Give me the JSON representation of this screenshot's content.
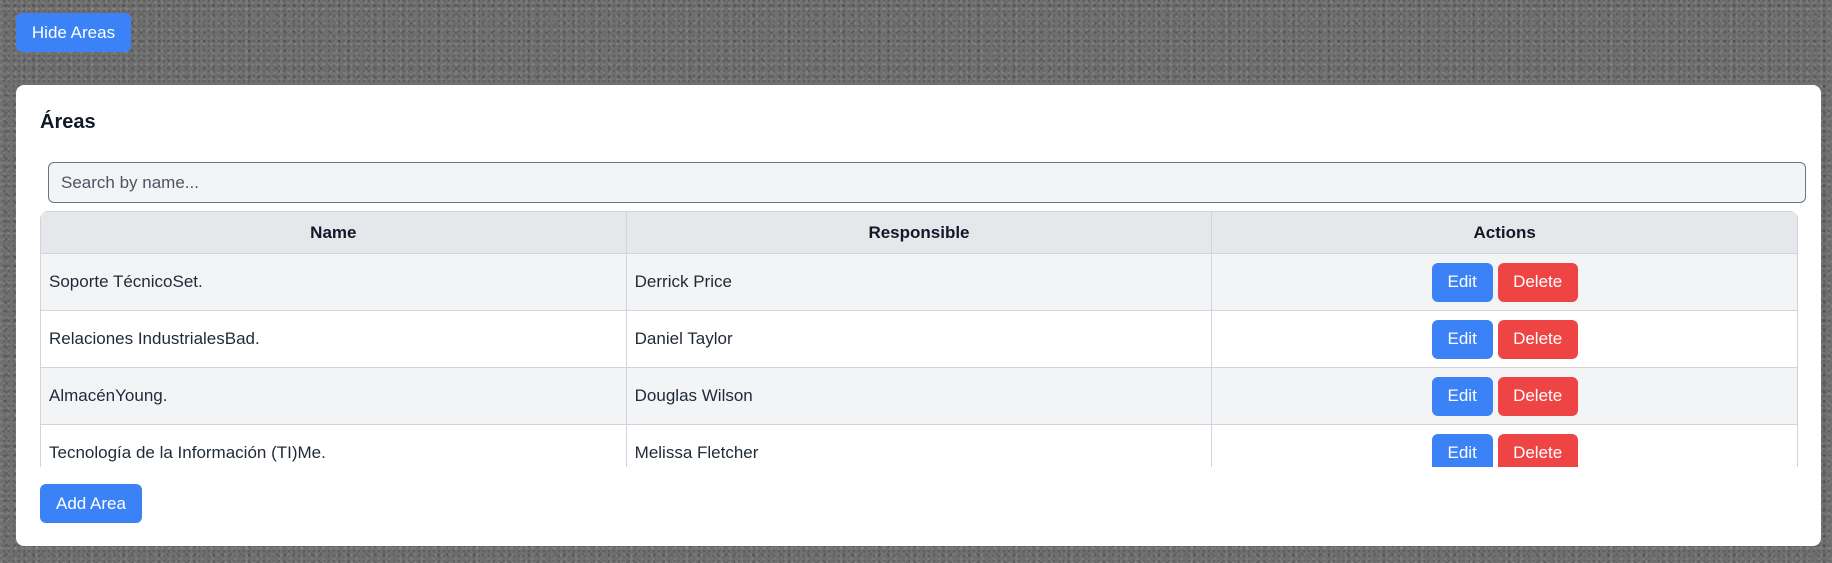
{
  "toggle_button": "Hide Areas",
  "card": {
    "title": "Áreas",
    "search_placeholder": "Search by name...",
    "add_button": "Add Area"
  },
  "table": {
    "headers": [
      "Name",
      "Responsible",
      "Actions"
    ],
    "rows": [
      {
        "name": "Soporte TécnicoSet.",
        "responsible": "Derrick Price"
      },
      {
        "name": "Relaciones IndustrialesBad.",
        "responsible": "Daniel Taylor"
      },
      {
        "name": "AlmacénYoung.",
        "responsible": "Douglas Wilson"
      },
      {
        "name": "Tecnología de la Información (TI)Me.",
        "responsible": "Melissa Fletcher"
      }
    ],
    "edit_label": "Edit",
    "delete_label": "Delete"
  },
  "colors": {
    "primary": "#3b82f6",
    "danger": "#ef4444",
    "header_bg": "#e5e7eb",
    "row_alt_bg": "#f3f4f6"
  }
}
